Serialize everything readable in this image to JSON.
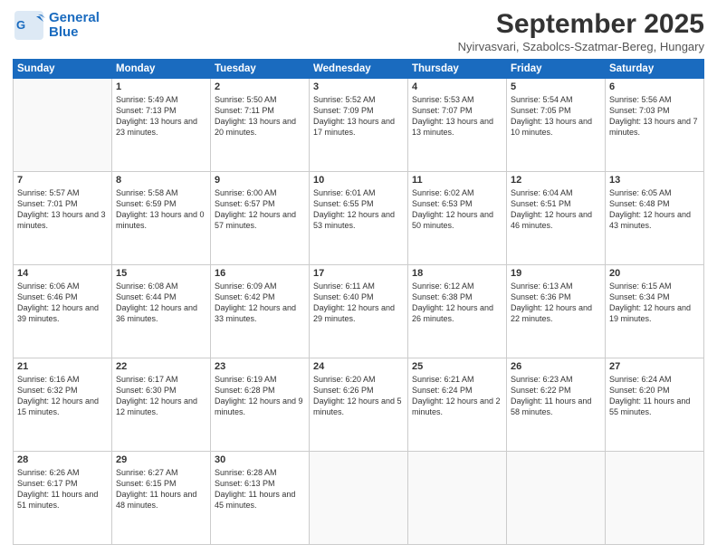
{
  "header": {
    "logo_line1": "General",
    "logo_line2": "Blue",
    "month_title": "September 2025",
    "location": "Nyirvasvari, Szabolcs-Szatmar-Bereg, Hungary"
  },
  "weekdays": [
    "Sunday",
    "Monday",
    "Tuesday",
    "Wednesday",
    "Thursday",
    "Friday",
    "Saturday"
  ],
  "weeks": [
    [
      {
        "day": "",
        "sunrise": "",
        "sunset": "",
        "daylight": ""
      },
      {
        "day": "1",
        "sunrise": "Sunrise: 5:49 AM",
        "sunset": "Sunset: 7:13 PM",
        "daylight": "Daylight: 13 hours and 23 minutes."
      },
      {
        "day": "2",
        "sunrise": "Sunrise: 5:50 AM",
        "sunset": "Sunset: 7:11 PM",
        "daylight": "Daylight: 13 hours and 20 minutes."
      },
      {
        "day": "3",
        "sunrise": "Sunrise: 5:52 AM",
        "sunset": "Sunset: 7:09 PM",
        "daylight": "Daylight: 13 hours and 17 minutes."
      },
      {
        "day": "4",
        "sunrise": "Sunrise: 5:53 AM",
        "sunset": "Sunset: 7:07 PM",
        "daylight": "Daylight: 13 hours and 13 minutes."
      },
      {
        "day": "5",
        "sunrise": "Sunrise: 5:54 AM",
        "sunset": "Sunset: 7:05 PM",
        "daylight": "Daylight: 13 hours and 10 minutes."
      },
      {
        "day": "6",
        "sunrise": "Sunrise: 5:56 AM",
        "sunset": "Sunset: 7:03 PM",
        "daylight": "Daylight: 13 hours and 7 minutes."
      }
    ],
    [
      {
        "day": "7",
        "sunrise": "Sunrise: 5:57 AM",
        "sunset": "Sunset: 7:01 PM",
        "daylight": "Daylight: 13 hours and 3 minutes."
      },
      {
        "day": "8",
        "sunrise": "Sunrise: 5:58 AM",
        "sunset": "Sunset: 6:59 PM",
        "daylight": "Daylight: 13 hours and 0 minutes."
      },
      {
        "day": "9",
        "sunrise": "Sunrise: 6:00 AM",
        "sunset": "Sunset: 6:57 PM",
        "daylight": "Daylight: 12 hours and 57 minutes."
      },
      {
        "day": "10",
        "sunrise": "Sunrise: 6:01 AM",
        "sunset": "Sunset: 6:55 PM",
        "daylight": "Daylight: 12 hours and 53 minutes."
      },
      {
        "day": "11",
        "sunrise": "Sunrise: 6:02 AM",
        "sunset": "Sunset: 6:53 PM",
        "daylight": "Daylight: 12 hours and 50 minutes."
      },
      {
        "day": "12",
        "sunrise": "Sunrise: 6:04 AM",
        "sunset": "Sunset: 6:51 PM",
        "daylight": "Daylight: 12 hours and 46 minutes."
      },
      {
        "day": "13",
        "sunrise": "Sunrise: 6:05 AM",
        "sunset": "Sunset: 6:48 PM",
        "daylight": "Daylight: 12 hours and 43 minutes."
      }
    ],
    [
      {
        "day": "14",
        "sunrise": "Sunrise: 6:06 AM",
        "sunset": "Sunset: 6:46 PM",
        "daylight": "Daylight: 12 hours and 39 minutes."
      },
      {
        "day": "15",
        "sunrise": "Sunrise: 6:08 AM",
        "sunset": "Sunset: 6:44 PM",
        "daylight": "Daylight: 12 hours and 36 minutes."
      },
      {
        "day": "16",
        "sunrise": "Sunrise: 6:09 AM",
        "sunset": "Sunset: 6:42 PM",
        "daylight": "Daylight: 12 hours and 33 minutes."
      },
      {
        "day": "17",
        "sunrise": "Sunrise: 6:11 AM",
        "sunset": "Sunset: 6:40 PM",
        "daylight": "Daylight: 12 hours and 29 minutes."
      },
      {
        "day": "18",
        "sunrise": "Sunrise: 6:12 AM",
        "sunset": "Sunset: 6:38 PM",
        "daylight": "Daylight: 12 hours and 26 minutes."
      },
      {
        "day": "19",
        "sunrise": "Sunrise: 6:13 AM",
        "sunset": "Sunset: 6:36 PM",
        "daylight": "Daylight: 12 hours and 22 minutes."
      },
      {
        "day": "20",
        "sunrise": "Sunrise: 6:15 AM",
        "sunset": "Sunset: 6:34 PM",
        "daylight": "Daylight: 12 hours and 19 minutes."
      }
    ],
    [
      {
        "day": "21",
        "sunrise": "Sunrise: 6:16 AM",
        "sunset": "Sunset: 6:32 PM",
        "daylight": "Daylight: 12 hours and 15 minutes."
      },
      {
        "day": "22",
        "sunrise": "Sunrise: 6:17 AM",
        "sunset": "Sunset: 6:30 PM",
        "daylight": "Daylight: 12 hours and 12 minutes."
      },
      {
        "day": "23",
        "sunrise": "Sunrise: 6:19 AM",
        "sunset": "Sunset: 6:28 PM",
        "daylight": "Daylight: 12 hours and 9 minutes."
      },
      {
        "day": "24",
        "sunrise": "Sunrise: 6:20 AM",
        "sunset": "Sunset: 6:26 PM",
        "daylight": "Daylight: 12 hours and 5 minutes."
      },
      {
        "day": "25",
        "sunrise": "Sunrise: 6:21 AM",
        "sunset": "Sunset: 6:24 PM",
        "daylight": "Daylight: 12 hours and 2 minutes."
      },
      {
        "day": "26",
        "sunrise": "Sunrise: 6:23 AM",
        "sunset": "Sunset: 6:22 PM",
        "daylight": "Daylight: 11 hours and 58 minutes."
      },
      {
        "day": "27",
        "sunrise": "Sunrise: 6:24 AM",
        "sunset": "Sunset: 6:20 PM",
        "daylight": "Daylight: 11 hours and 55 minutes."
      }
    ],
    [
      {
        "day": "28",
        "sunrise": "Sunrise: 6:26 AM",
        "sunset": "Sunset: 6:17 PM",
        "daylight": "Daylight: 11 hours and 51 minutes."
      },
      {
        "day": "29",
        "sunrise": "Sunrise: 6:27 AM",
        "sunset": "Sunset: 6:15 PM",
        "daylight": "Daylight: 11 hours and 48 minutes."
      },
      {
        "day": "30",
        "sunrise": "Sunrise: 6:28 AM",
        "sunset": "Sunset: 6:13 PM",
        "daylight": "Daylight: 11 hours and 45 minutes."
      },
      {
        "day": "",
        "sunrise": "",
        "sunset": "",
        "daylight": ""
      },
      {
        "day": "",
        "sunrise": "",
        "sunset": "",
        "daylight": ""
      },
      {
        "day": "",
        "sunrise": "",
        "sunset": "",
        "daylight": ""
      },
      {
        "day": "",
        "sunrise": "",
        "sunset": "",
        "daylight": ""
      }
    ]
  ]
}
